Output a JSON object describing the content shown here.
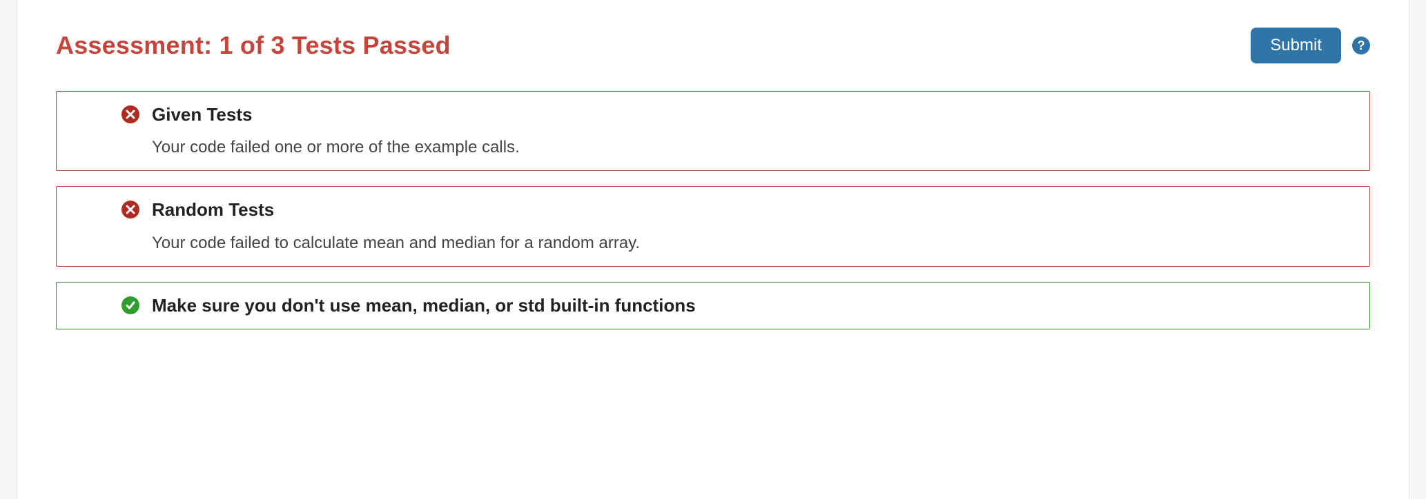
{
  "header": {
    "title": "Assessment: 1 of 3 Tests Passed",
    "submit_label": "Submit"
  },
  "tests": [
    {
      "status": "fail",
      "title": "Given Tests",
      "description": "Your code failed one or more of the example calls."
    },
    {
      "status": "fail",
      "title": "Random Tests",
      "description": "Your code failed to calculate mean and median for a random array."
    },
    {
      "status": "pass",
      "title": "Make sure you don't use mean, median, or std built-in functions",
      "description": ""
    }
  ]
}
